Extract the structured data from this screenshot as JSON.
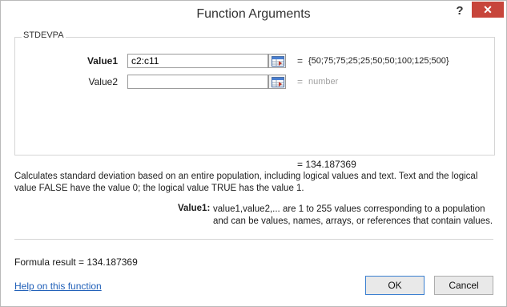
{
  "dialog": {
    "title": "Function Arguments",
    "help_glyph": "?",
    "close_glyph": "✕"
  },
  "function_name": "STDEVPA",
  "arguments": [
    {
      "label": "Value1",
      "value": "c2:c11",
      "evaluated": "{50;75;75;25;25;50;50;100;125;500}",
      "eq": "="
    },
    {
      "label": "Value2",
      "value": "",
      "evaluated": "number",
      "eq": "="
    }
  ],
  "result_preview": "=  134.187369",
  "description": "Calculates standard deviation based on an entire population, including logical values and text. Text and the logical value FALSE have the value 0; the logical value TRUE has the value 1.",
  "argument_help": {
    "name": "Value1:",
    "text": "value1,value2,... are 1 to 255 values corresponding to a population and can be values, names, arrays, or references that contain values."
  },
  "formula_result": "Formula result =   134.187369",
  "help_link": "Help on this function",
  "buttons": {
    "ok": "OK",
    "cancel": "Cancel"
  },
  "colors": {
    "close_bg": "#c7453b",
    "link": "#1f5fb8"
  },
  "icons": {
    "ref_button": "collapse-dialog-icon"
  }
}
